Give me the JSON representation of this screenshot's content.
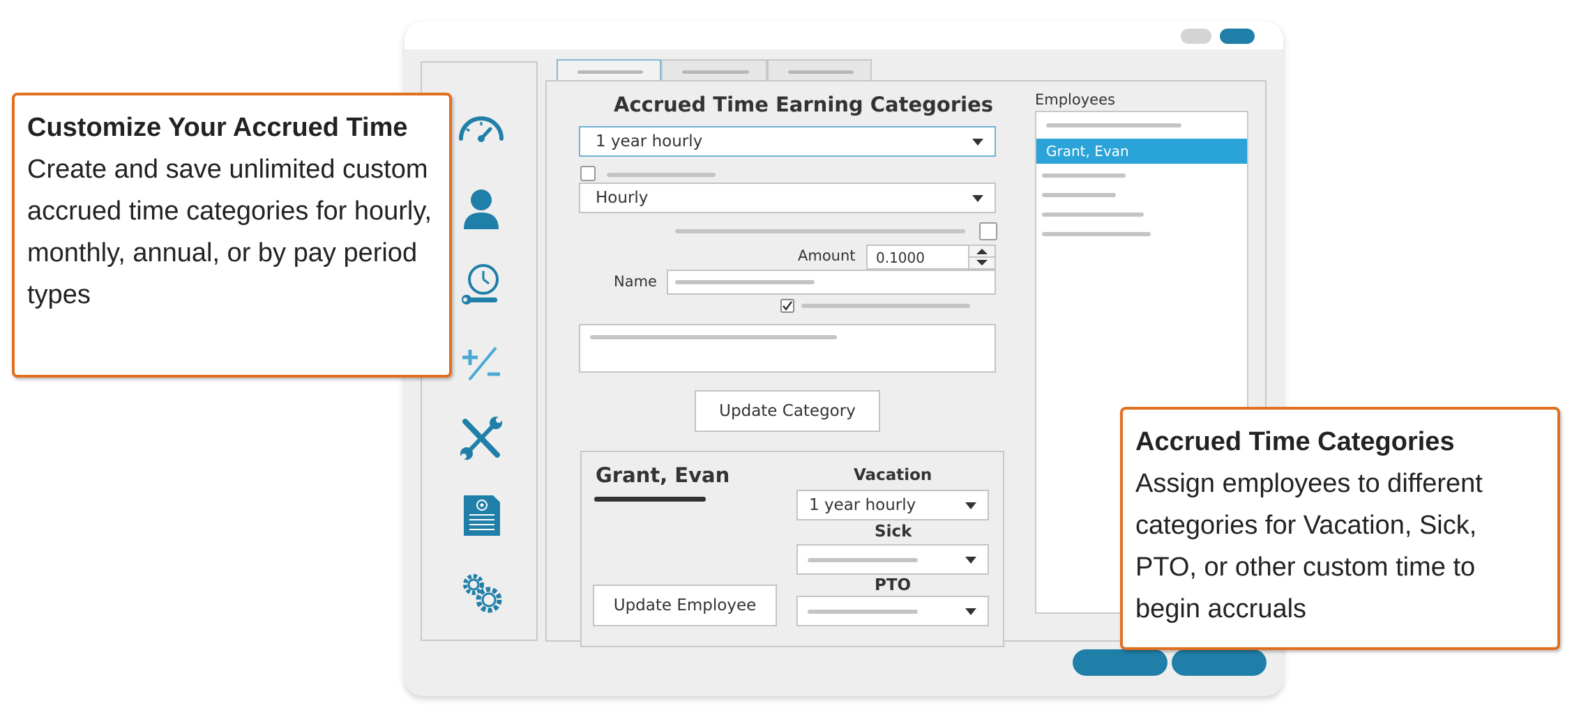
{
  "colors": {
    "accent": "#1f7fa8",
    "selection": "#2aa3d8",
    "callout_border": "#e07020"
  },
  "sidebar": {
    "icons": [
      "dashboard-gauge-icon",
      "user-icon",
      "clock-wrench-icon",
      "plus-minus-icon",
      "tools-icon",
      "document-icon",
      "gears-icon"
    ]
  },
  "category_form": {
    "title": "Accrued Time Earning Categories",
    "category_select": "1 year hourly",
    "type_select": "Hourly",
    "amount_label": "Amount",
    "amount_value": "0.1000",
    "name_label": "Name",
    "update_button": "Update Category"
  },
  "employee_panel": {
    "employee_name": "Grant, Evan",
    "vacation_label": "Vacation",
    "vacation_value": "1 year hourly",
    "sick_label": "Sick",
    "pto_label": "PTO",
    "update_button": "Update Employee"
  },
  "employees": {
    "label": "Employees",
    "selected": "Grant, Evan"
  },
  "callouts": {
    "left": {
      "title": "Customize Your Accrued Time",
      "body": "Create and save unlimited custom accrued time categories for hourly, monthly, annual, or by pay period types"
    },
    "right": {
      "title": "Accrued Time Categories",
      "body": "Assign employees to different categories for Vacation, Sick, PTO, or other custom time to begin accruals"
    }
  }
}
